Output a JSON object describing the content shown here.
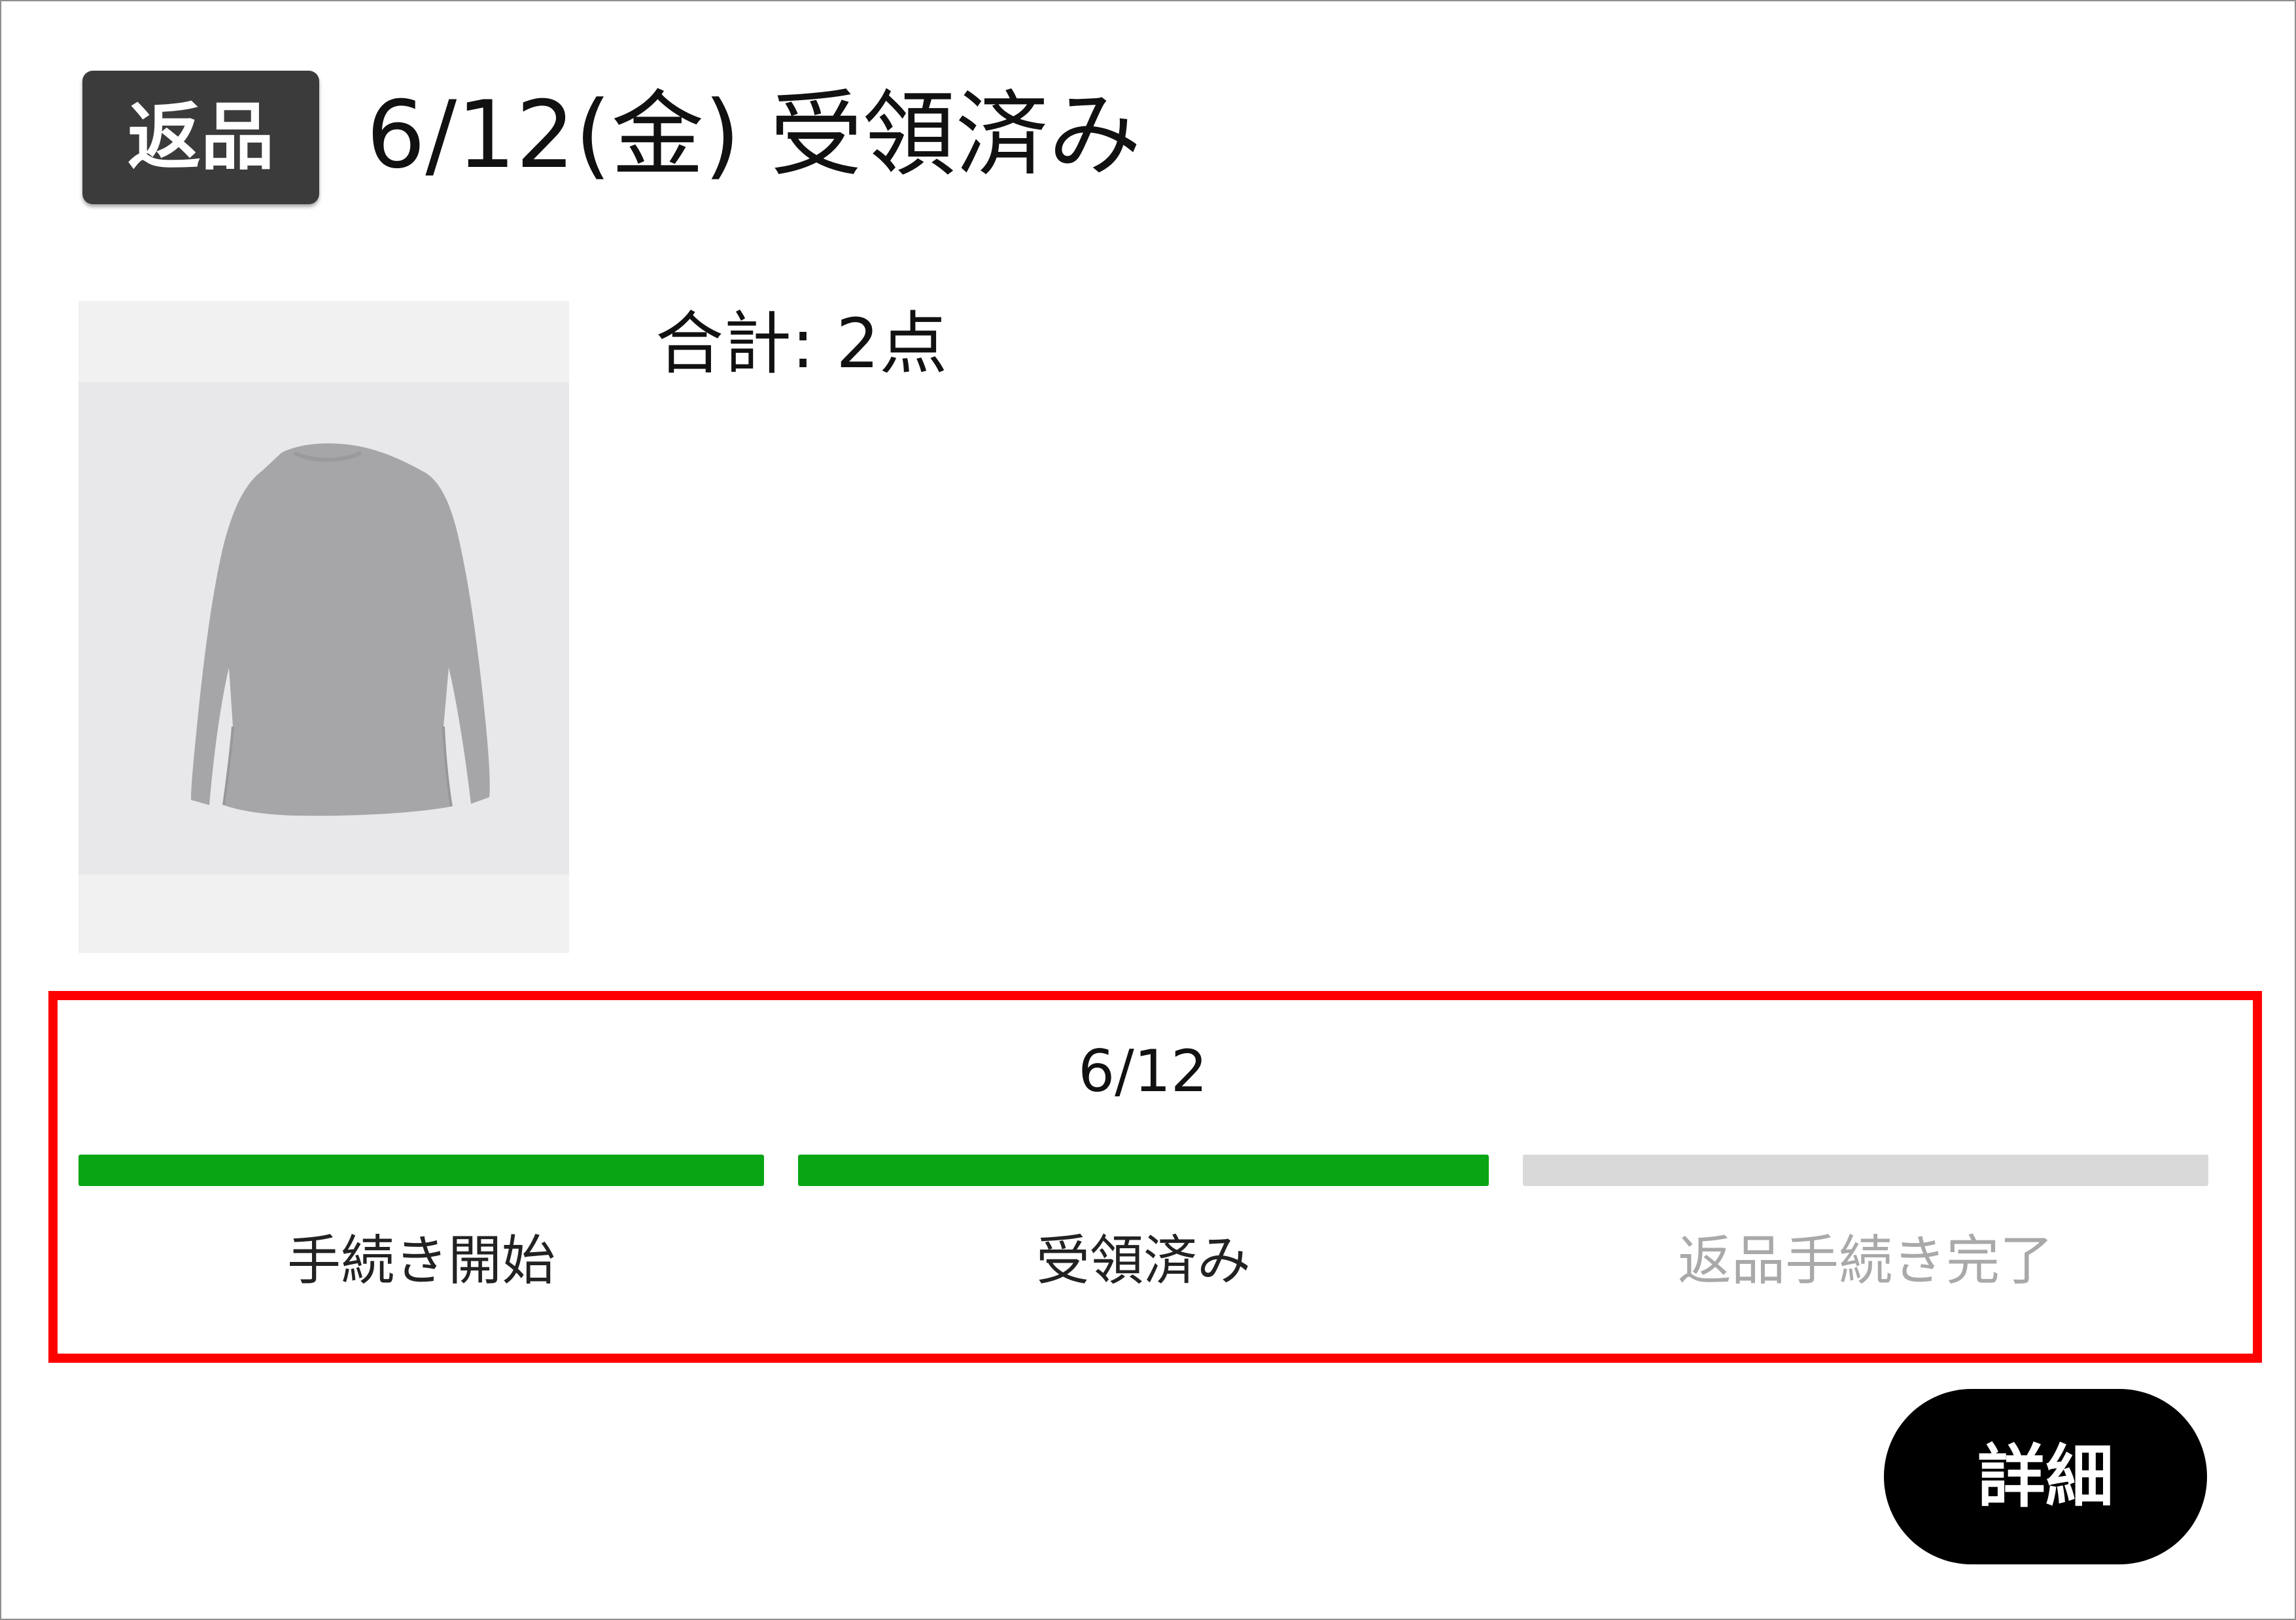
{
  "badge": {
    "label": "返品"
  },
  "header": {
    "title": "6/12(金) 受領済み"
  },
  "product": {
    "image_icon": "long-sleeve-shirt-icon",
    "shirt_color": "#a6a6a8"
  },
  "summary": {
    "total": "合計: 2点"
  },
  "progress": {
    "date": "6/12",
    "completed_steps": 2,
    "total_steps": 3,
    "steps": [
      {
        "label": "手続き開始",
        "state": "done"
      },
      {
        "label": "受領済み",
        "state": "done"
      },
      {
        "label": "返品手続き完了",
        "state": "todo"
      }
    ],
    "done_color": "#0aa514",
    "todo_color": "#d9d9d9"
  },
  "highlight_color": "#ff0000",
  "actions": {
    "detail_label": "詳細"
  }
}
